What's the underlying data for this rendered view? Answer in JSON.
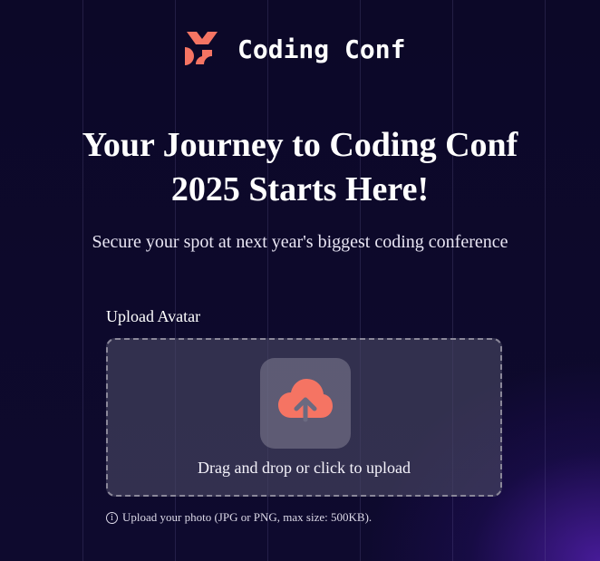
{
  "brand": {
    "name": "Coding Conf",
    "accent": "#f57463"
  },
  "hero": {
    "headline_line1": "Your Journey to Coding Conf",
    "headline_line2": "2025 Starts Here!",
    "subtitle": "Secure your spot at next year's biggest coding conference"
  },
  "form": {
    "avatar_label": "Upload Avatar",
    "dropzone_text": "Drag and drop or click to upload",
    "upload_icon": "cloud-upload-icon",
    "hint_icon": "info-icon",
    "hint_text": "Upload your photo (JPG or PNG, max size: 500KB)."
  }
}
